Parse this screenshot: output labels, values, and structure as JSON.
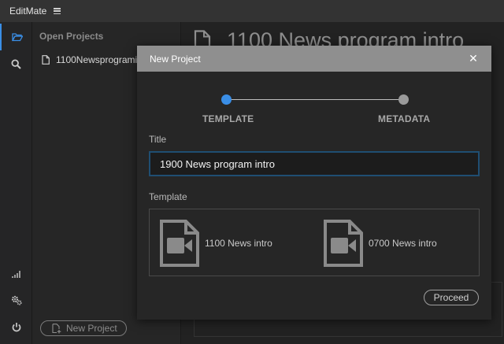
{
  "app": {
    "title": "EditMate"
  },
  "projects": {
    "header": "Open Projects",
    "items": [
      {
        "label": "1100Newsprogramintro"
      }
    ],
    "new_project_label": "New Project"
  },
  "main": {
    "title": "1100 News program intro"
  },
  "dialog": {
    "title": "New Project",
    "close_glyph": "✕",
    "steps": [
      {
        "label": "TEMPLATE",
        "state": "active"
      },
      {
        "label": "METADATA",
        "state": "inactive"
      }
    ],
    "title_field": {
      "label": "Title",
      "value": "1900 News program intro"
    },
    "template_field": {
      "label": "Template",
      "options": [
        {
          "name": "1100 News intro",
          "icon": "video-file-icon"
        },
        {
          "name": "0700 News intro",
          "icon": "video-file-icon"
        }
      ]
    },
    "proceed_label": "Proceed"
  },
  "rail": {
    "icons": [
      "folder-open-icon",
      "search-icon",
      "signal-bars-icon",
      "gears-icon",
      "power-icon"
    ]
  },
  "colors": {
    "accent": "#3a8ee6",
    "dialog_header": "#8f8f8f",
    "input_border": "#1f4e72"
  }
}
